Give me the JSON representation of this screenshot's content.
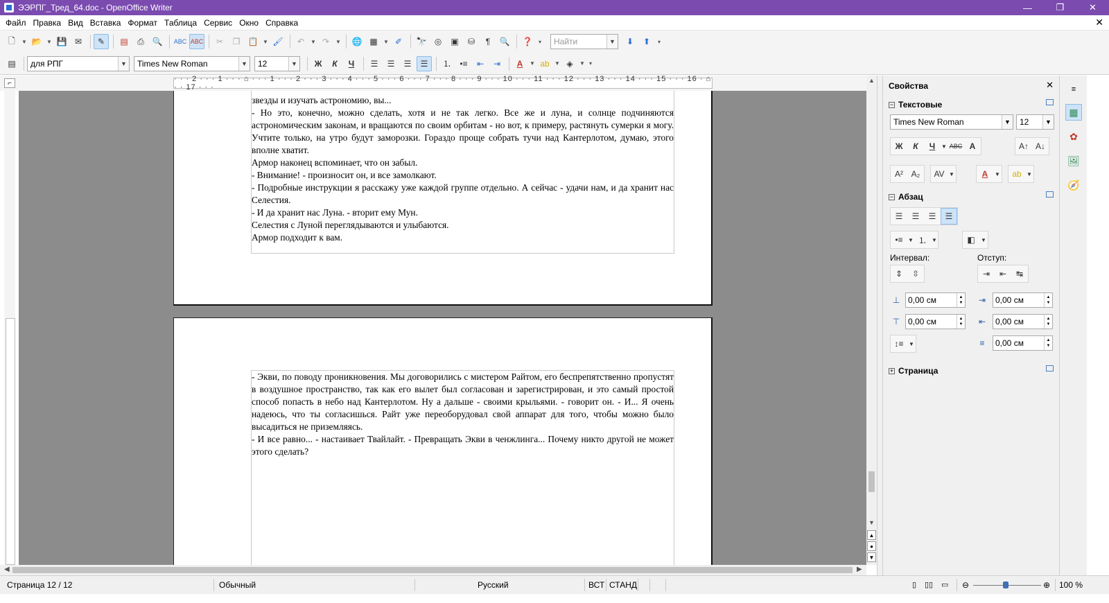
{
  "window": {
    "title": "ЭЭРПГ_Тред_64.doc - OpenOffice Writer",
    "minimize": "—",
    "restore": "❐",
    "close": "✕"
  },
  "menu": {
    "items": [
      "Файл",
      "Правка",
      "Вид",
      "Вставка",
      "Формат",
      "Таблица",
      "Сервис",
      "Окно",
      "Справка"
    ],
    "doc_close": "✕"
  },
  "toolbar1": {
    "find_placeholder": "Найти"
  },
  "toolbar2": {
    "paragraph_style": "для РПГ",
    "font_name": "Times New Roman",
    "font_size": "12",
    "bold": "Ж",
    "italic": "К",
    "underline": "Ч"
  },
  "ruler": {
    "ticks": "· · · 2 · · · 1 · · · ⌂ · · · 1 · · · 2 · · · 3 · · · 4 · · · 5 · · · 6 · · · 7 · · · 8 · · · 9 · · · 10 · · · 11 · · · 12 · · · 13 · · · 14 · · · 15 · · · 16 · ⌂ · · 17 · · ·"
  },
  "page1": {
    "paragraphs": [
      "звезды и изучать астрономию, вы...",
      "- Но это, конечно, можно сделать, хотя и не так легко. Все же и луна, и солнце подчиняются астрономическим законам, и вращаются по своим орбитам - но вот, к примеру, растянуть сумерки я могу. Учтите только, на утро будут заморозки. Гораздо проще собрать тучи над Кантерлотом, думаю, этого вполне хватит.",
      "Армор наконец вспоминает, что он забыл.",
      "- Внимание! - произносит он, и все замолкают.",
      "- Подробные инструкции я расскажу уже каждой группе отдельно. А сейчас - удачи нам, и да хранит нас Селестия.",
      "- И да хранит нас Луна. - вторит ему Мун.",
      "Селестия с Луной переглядываются и улыбаются.",
      "Армор подходит к вам."
    ]
  },
  "page2": {
    "paragraphs": [
      "- Экви, по поводу проникновения. Мы договорились с мистером Райтом, его беспрепятственно пропустят в воздушное пространство, так как его вылет был согласован и зарегистрирован, и это самый простой способ попасть в небо над Кантерлотом. Ну а дальше - своими крыльями. - говорит он. - И... Я очень надеюсь, что ты согласишься. Райт уже переоборудовал свой аппарат для того, чтобы можно было высадиться не приземляясь.",
      "- И все равно... - настаивает Твайлайт. - Превращать Экви в ченжлинга... Почему никто другой не может этого сделать?"
    ]
  },
  "sidebar": {
    "title": "Свойства",
    "section_text": "Текстовые",
    "font_name": "Times New Roman",
    "font_size": "12",
    "section_paragraph": "Абзац",
    "interval_label": "Интервал:",
    "indent_label": "Отступ:",
    "spacing_above": "0,00 см",
    "spacing_below": "0,00 см",
    "indent_before": "0,00 см",
    "indent_after": "0,00 см",
    "indent_first": "0,00 см",
    "section_page": "Страница"
  },
  "status": {
    "page": "Страница  12 / 12",
    "style": "Обычный",
    "language": "Русский",
    "insert_mode": "ВСТ",
    "selection_mode": "СТАНД",
    "zoom": "100 %"
  },
  "colors": {
    "titlebar": "#7b4bb0",
    "workspace": "#8c8c8c",
    "spellcheck": "#e33"
  }
}
